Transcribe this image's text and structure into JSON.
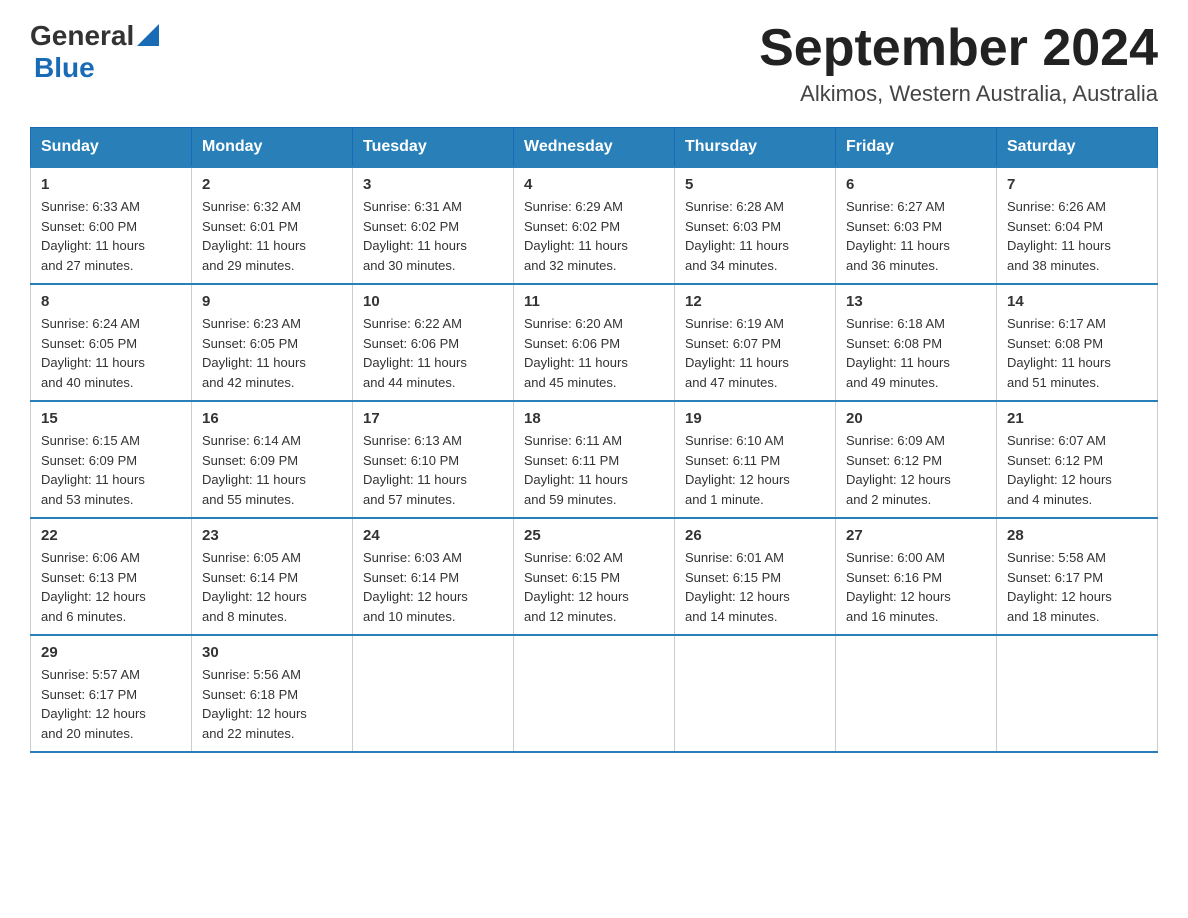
{
  "header": {
    "title": "September 2024",
    "subtitle": "Alkimos, Western Australia, Australia",
    "logo_general": "General",
    "logo_blue": "Blue"
  },
  "days_of_week": [
    "Sunday",
    "Monday",
    "Tuesday",
    "Wednesday",
    "Thursday",
    "Friday",
    "Saturday"
  ],
  "weeks": [
    [
      {
        "day": "1",
        "sunrise": "6:33 AM",
        "sunset": "6:00 PM",
        "daylight": "11 hours and 27 minutes."
      },
      {
        "day": "2",
        "sunrise": "6:32 AM",
        "sunset": "6:01 PM",
        "daylight": "11 hours and 29 minutes."
      },
      {
        "day": "3",
        "sunrise": "6:31 AM",
        "sunset": "6:02 PM",
        "daylight": "11 hours and 30 minutes."
      },
      {
        "day": "4",
        "sunrise": "6:29 AM",
        "sunset": "6:02 PM",
        "daylight": "11 hours and 32 minutes."
      },
      {
        "day": "5",
        "sunrise": "6:28 AM",
        "sunset": "6:03 PM",
        "daylight": "11 hours and 34 minutes."
      },
      {
        "day": "6",
        "sunrise": "6:27 AM",
        "sunset": "6:03 PM",
        "daylight": "11 hours and 36 minutes."
      },
      {
        "day": "7",
        "sunrise": "6:26 AM",
        "sunset": "6:04 PM",
        "daylight": "11 hours and 38 minutes."
      }
    ],
    [
      {
        "day": "8",
        "sunrise": "6:24 AM",
        "sunset": "6:05 PM",
        "daylight": "11 hours and 40 minutes."
      },
      {
        "day": "9",
        "sunrise": "6:23 AM",
        "sunset": "6:05 PM",
        "daylight": "11 hours and 42 minutes."
      },
      {
        "day": "10",
        "sunrise": "6:22 AM",
        "sunset": "6:06 PM",
        "daylight": "11 hours and 44 minutes."
      },
      {
        "day": "11",
        "sunrise": "6:20 AM",
        "sunset": "6:06 PM",
        "daylight": "11 hours and 45 minutes."
      },
      {
        "day": "12",
        "sunrise": "6:19 AM",
        "sunset": "6:07 PM",
        "daylight": "11 hours and 47 minutes."
      },
      {
        "day": "13",
        "sunrise": "6:18 AM",
        "sunset": "6:08 PM",
        "daylight": "11 hours and 49 minutes."
      },
      {
        "day": "14",
        "sunrise": "6:17 AM",
        "sunset": "6:08 PM",
        "daylight": "11 hours and 51 minutes."
      }
    ],
    [
      {
        "day": "15",
        "sunrise": "6:15 AM",
        "sunset": "6:09 PM",
        "daylight": "11 hours and 53 minutes."
      },
      {
        "day": "16",
        "sunrise": "6:14 AM",
        "sunset": "6:09 PM",
        "daylight": "11 hours and 55 minutes."
      },
      {
        "day": "17",
        "sunrise": "6:13 AM",
        "sunset": "6:10 PM",
        "daylight": "11 hours and 57 minutes."
      },
      {
        "day": "18",
        "sunrise": "6:11 AM",
        "sunset": "6:11 PM",
        "daylight": "11 hours and 59 minutes."
      },
      {
        "day": "19",
        "sunrise": "6:10 AM",
        "sunset": "6:11 PM",
        "daylight": "12 hours and 1 minute."
      },
      {
        "day": "20",
        "sunrise": "6:09 AM",
        "sunset": "6:12 PM",
        "daylight": "12 hours and 2 minutes."
      },
      {
        "day": "21",
        "sunrise": "6:07 AM",
        "sunset": "6:12 PM",
        "daylight": "12 hours and 4 minutes."
      }
    ],
    [
      {
        "day": "22",
        "sunrise": "6:06 AM",
        "sunset": "6:13 PM",
        "daylight": "12 hours and 6 minutes."
      },
      {
        "day": "23",
        "sunrise": "6:05 AM",
        "sunset": "6:14 PM",
        "daylight": "12 hours and 8 minutes."
      },
      {
        "day": "24",
        "sunrise": "6:03 AM",
        "sunset": "6:14 PM",
        "daylight": "12 hours and 10 minutes."
      },
      {
        "day": "25",
        "sunrise": "6:02 AM",
        "sunset": "6:15 PM",
        "daylight": "12 hours and 12 minutes."
      },
      {
        "day": "26",
        "sunrise": "6:01 AM",
        "sunset": "6:15 PM",
        "daylight": "12 hours and 14 minutes."
      },
      {
        "day": "27",
        "sunrise": "6:00 AM",
        "sunset": "6:16 PM",
        "daylight": "12 hours and 16 minutes."
      },
      {
        "day": "28",
        "sunrise": "5:58 AM",
        "sunset": "6:17 PM",
        "daylight": "12 hours and 18 minutes."
      }
    ],
    [
      {
        "day": "29",
        "sunrise": "5:57 AM",
        "sunset": "6:17 PM",
        "daylight": "12 hours and 20 minutes."
      },
      {
        "day": "30",
        "sunrise": "5:56 AM",
        "sunset": "6:18 PM",
        "daylight": "12 hours and 22 minutes."
      },
      null,
      null,
      null,
      null,
      null
    ]
  ],
  "labels": {
    "sunrise": "Sunrise:",
    "sunset": "Sunset:",
    "daylight": "Daylight:"
  }
}
